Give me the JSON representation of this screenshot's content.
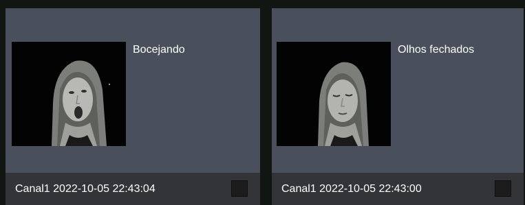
{
  "alerts": [
    {
      "event": "Bocejando",
      "channel": "Canal1",
      "timestamp": "2022-10-05 22:43:04",
      "meta": "Canal1 2022-10-05 22:43:04",
      "snapshot_icon": "face-snapshot-yawning"
    },
    {
      "event": "Olhos fechados",
      "channel": "Canal1",
      "timestamp": "2022-10-05 22:43:00",
      "meta": "Canal1 2022-10-05 22:43:00",
      "snapshot_icon": "face-snapshot-eyes-closed"
    }
  ],
  "colors": {
    "background": "#111613",
    "card": "#4a505b",
    "footer": "#323438",
    "text": "#ffffff"
  }
}
